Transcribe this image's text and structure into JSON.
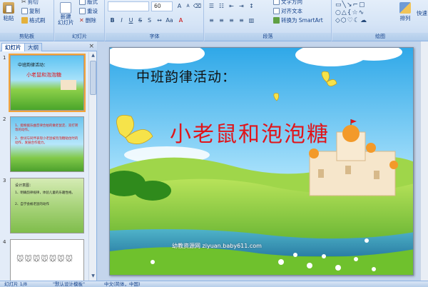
{
  "ribbon": {
    "clipboard": {
      "label": "剪贴板",
      "paste": "粘贴",
      "cut": "剪切",
      "copy": "复制",
      "format_painter": "格式刷"
    },
    "slides": {
      "label": "幻灯片",
      "new_slide": "新建\n幻灯片",
      "layout": "版式",
      "reset": "重设",
      "delete": "删除"
    },
    "font": {
      "label": "字体",
      "font_size": "60"
    },
    "paragraph": {
      "label": "段落",
      "text_direction": "文字方向",
      "align_text": "对齐文本",
      "smartart": "转换为 SmartArt"
    },
    "drawing": {
      "label": "绘图",
      "arrange": "排列",
      "quick_styles": "快速"
    }
  },
  "panel": {
    "tabs": [
      "幻灯片",
      "大纲"
    ],
    "close": "×",
    "thumbnails": [
      {
        "number": "1",
        "title": "中班韵律活动：",
        "subtitle": "小老鼠和泡泡糖"
      },
      {
        "number": "2",
        "lines": [
          "1、能根据乐曲音律合拍的做老鼠走、双打转等的动作。",
          "2、尝试与同伴表现小老鼠被泡泡糖粘住时的动作，发展合作能力。"
        ]
      },
      {
        "number": "3",
        "heading": "设计意图：",
        "lines": [
          "1、明确韵律规律，体验儿童的乐趣性格。",
          "2、自学会被老鼠的动作"
        ]
      },
      {
        "number": "4"
      }
    ]
  },
  "slide": {
    "subtitle": "中班韵律活动：",
    "title": "小老鼠和泡泡糖",
    "watermark": "幼教资源网 ziyuan.baby611.com"
  },
  "status": {
    "slide_counter": "幻灯片 1/8",
    "theme": "\"默认设计模板\"",
    "language": "中文(简体，中国)"
  },
  "colors": {
    "title_red": "#e0151b",
    "ribbon_text": "#15428b",
    "selection": "#f3a43a"
  }
}
